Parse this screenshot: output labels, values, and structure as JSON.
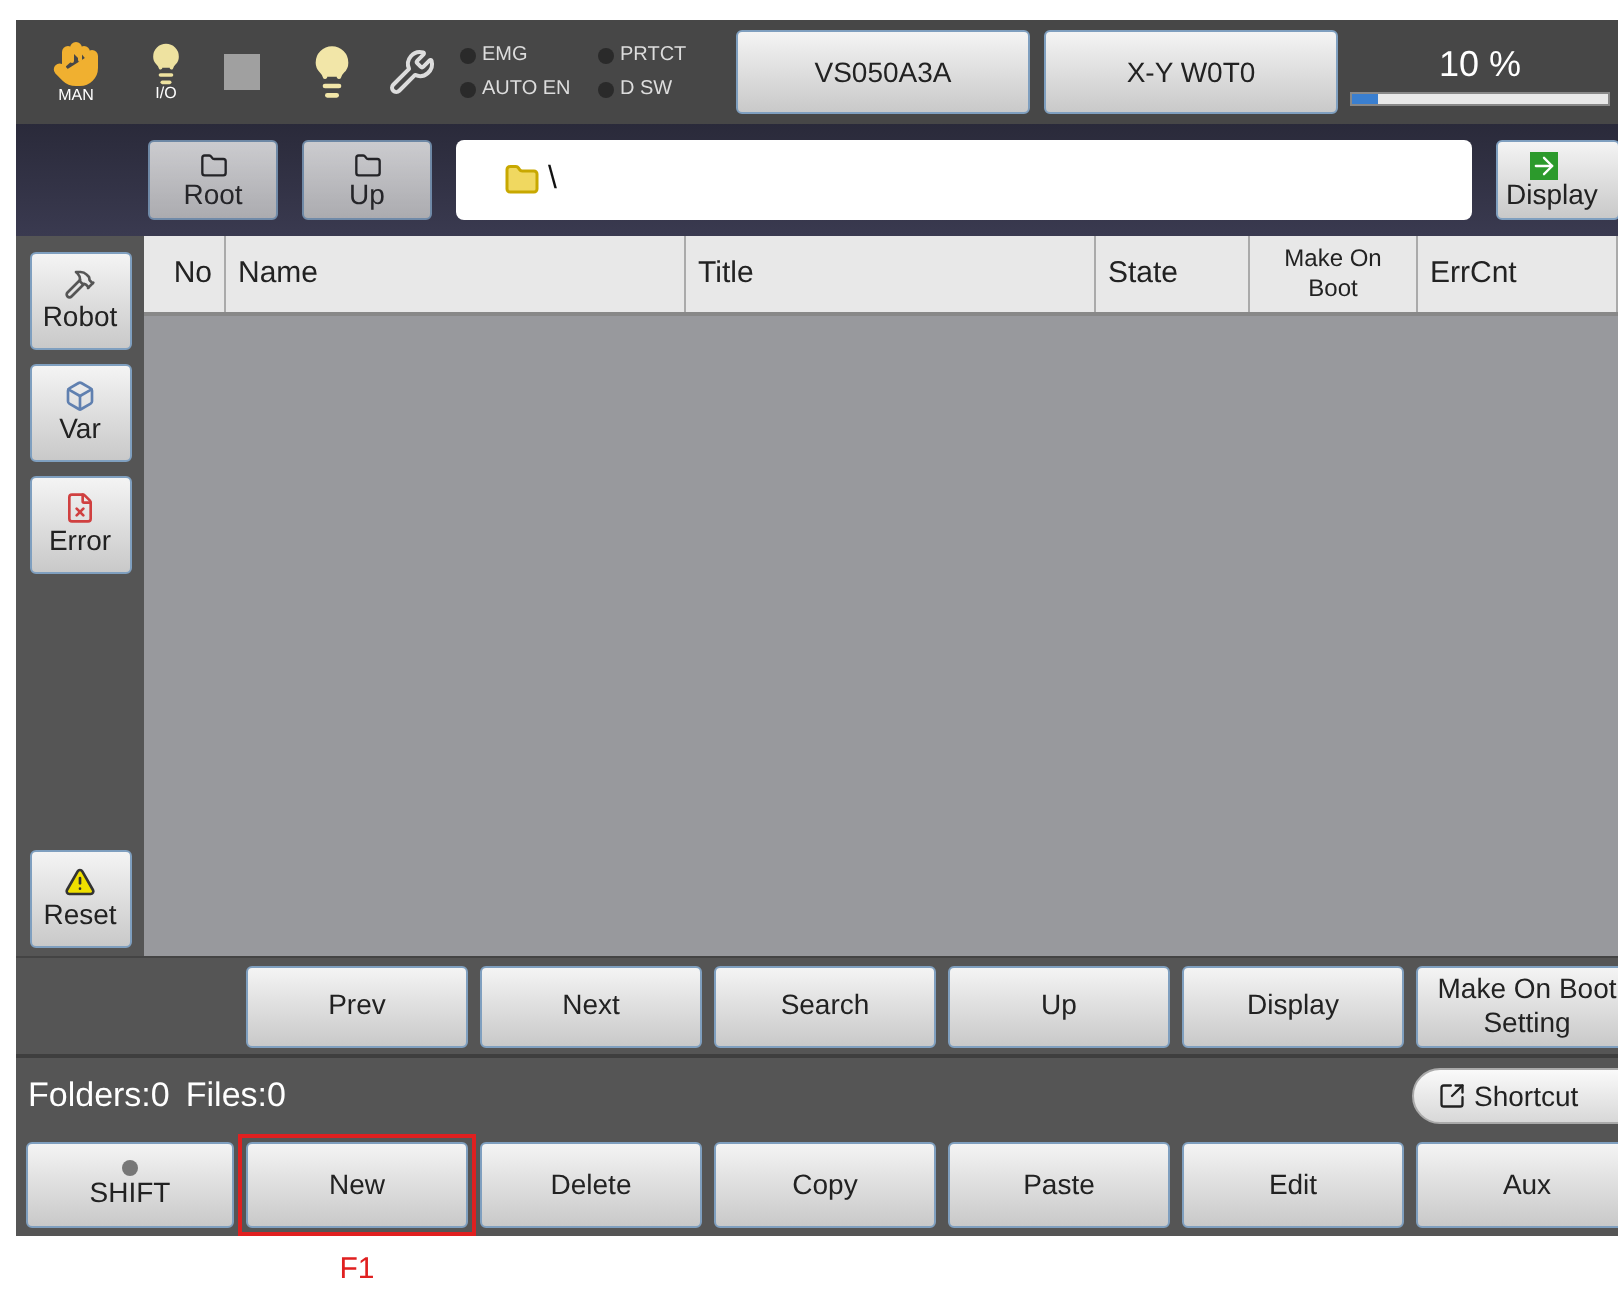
{
  "top_bar": {
    "mode_label": "MAN",
    "io_label": "I/O",
    "indicators": [
      {
        "label": "EMG",
        "on": false
      },
      {
        "label": "PRTCT",
        "on": false
      },
      {
        "label": "AUTO EN",
        "on": false
      },
      {
        "label": "D SW",
        "on": false
      }
    ],
    "robot_button": "VS050A3A",
    "coord_button": "X-Y W0T0",
    "speed": {
      "reading": "10 %",
      "level": 0.1
    }
  },
  "path_bar": {
    "buttons": [
      {
        "label": "Root",
        "disabled": true
      },
      {
        "label": "Up",
        "disabled": true
      }
    ],
    "path": "\\",
    "display_button": "Display"
  },
  "side_buttons": [
    {
      "kind": "robot",
      "label": "Robot"
    },
    {
      "kind": "var",
      "label": "Var"
    },
    {
      "kind": "error",
      "label": "Error"
    }
  ],
  "reset_button": "Reset",
  "table": {
    "columns": [
      "No",
      "Name",
      "Title",
      "State",
      "Make On Boot",
      "ErrCnt"
    ]
  },
  "function_buttons": [
    "Prev",
    "Next",
    "Search",
    "Up",
    "Display",
    "Make On Boot Setting"
  ],
  "status": {
    "folders": "Folders:0",
    "files": "Files:0",
    "shortcut": "Shortcut"
  },
  "shift_button": {
    "label": "SHIFT",
    "on": false
  },
  "bottom_buttons": [
    {
      "label": "New",
      "marked": true
    },
    {
      "label": "Delete",
      "marked": false
    },
    {
      "label": "Copy",
      "marked": false
    },
    {
      "label": "Paste",
      "marked": false
    },
    {
      "label": "Edit",
      "marked": false
    },
    {
      "label": "Aux",
      "marked": false
    }
  ],
  "callout_label": "F1"
}
